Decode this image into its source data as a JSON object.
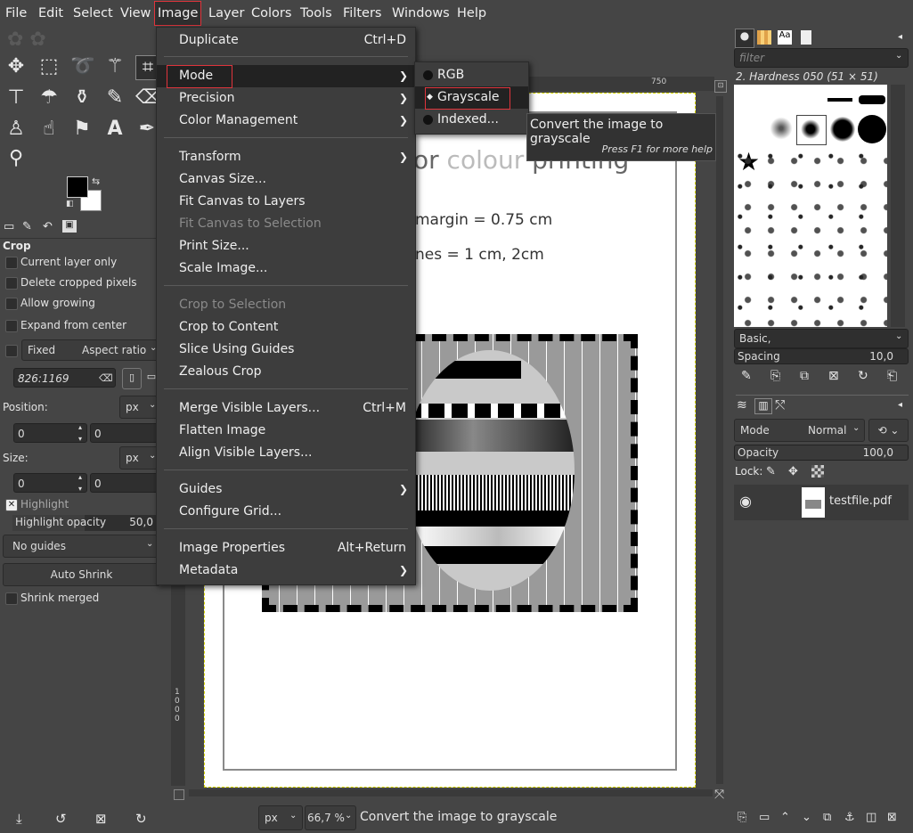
{
  "menubar": [
    "File",
    "Edit",
    "Select",
    "View",
    "Image",
    "Layer",
    "Colors",
    "Tools",
    "Filters",
    "Windows",
    "Help"
  ],
  "image_menu": {
    "duplicate": {
      "label": "Duplicate",
      "accel": "Ctrl+D"
    },
    "mode": "Mode",
    "precision": "Precision",
    "color_management": "Color Management",
    "transform": "Transform",
    "canvas_size": "Canvas Size...",
    "fit_canvas_layers": "Fit Canvas to Layers",
    "fit_canvas_selection": "Fit Canvas to Selection",
    "print_size": "Print Size...",
    "scale_image": "Scale Image...",
    "crop_selection": "Crop to Selection",
    "crop_content": "Crop to Content",
    "slice_guides": "Slice Using Guides",
    "zealous_crop": "Zealous Crop",
    "merge_visible": {
      "label": "Merge Visible Layers...",
      "accel": "Ctrl+M"
    },
    "flatten": "Flatten Image",
    "align_visible": "Align Visible Layers...",
    "guides": "Guides",
    "configure_grid": "Configure Grid...",
    "image_properties": {
      "label": "Image Properties",
      "accel": "Alt+Return"
    },
    "metadata": "Metadata"
  },
  "mode_menu": {
    "rgb": "RGB",
    "grayscale": "Grayscale",
    "indexed": "Indexed..."
  },
  "tooltip": {
    "main": "Convert the image to grayscale",
    "help": "Press F1 for more help"
  },
  "canvas": {
    "title_frag1": "or ",
    "title_frag2": "colour",
    "title_frag3": " printing",
    "line1": "margin = 0.75 cm",
    "line2": "nes = 1 cm, 2cm",
    "ruler_750": "750",
    "ruler_left": "1000"
  },
  "tool_options": {
    "title": "Crop",
    "current_layer_only": "Current layer only",
    "delete_cropped": "Delete cropped pixels",
    "allow_growing": "Allow growing",
    "expand_center": "Expand from center",
    "fixed": "Fixed",
    "aspect": "Aspect ratio",
    "ratio_value": "826:1169",
    "position_label": "Position:",
    "unit": "px",
    "pos_x": "0",
    "pos_y": "0",
    "size_label": "Size:",
    "size_x": "0",
    "size_y": "0",
    "highlight": "Highlight",
    "highlight_opacity": "Highlight opacity",
    "highlight_opacity_value": "50,0",
    "guides": "No guides",
    "auto_shrink": "Auto Shrink",
    "shrink_merged": "Shrink merged"
  },
  "status": {
    "unit": "px",
    "zoom": "66,7 %",
    "message": "Convert the image to grayscale"
  },
  "brushes": {
    "filter_placeholder": "filter",
    "current": "2. Hardness 050 (51 × 51)",
    "tag": "Basic,",
    "spacing_label": "Spacing",
    "spacing_value": "10,0"
  },
  "layers": {
    "mode_label": "Mode",
    "mode_value": "Normal",
    "opacity_label": "Opacity",
    "opacity_value": "100,0",
    "lock_label": "Lock:",
    "layer_name": "testfile.pdf"
  }
}
